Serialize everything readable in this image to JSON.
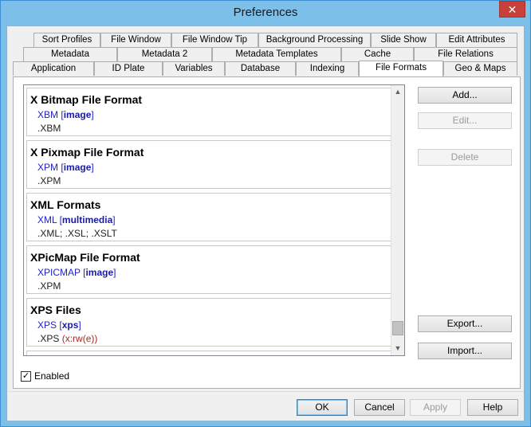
{
  "window": {
    "title": "Preferences",
    "close_glyph": "✕"
  },
  "tabs": {
    "row1": [
      "Sort Profiles",
      "File Window",
      "File Window Tip",
      "Background Processing",
      "Slide Show",
      "Edit Attributes"
    ],
    "row2": [
      "Metadata",
      "Metadata 2",
      "Metadata Templates",
      "Cache",
      "File Relations"
    ],
    "row3": [
      "Application",
      "ID Plate",
      "Variables",
      "Database",
      "Indexing",
      "File Formats",
      "Geo & Maps"
    ],
    "active": "File Formats"
  },
  "formats": [
    {
      "title": "X Bitmap File Format",
      "code": "XBM",
      "category": "image",
      "extensions": ".XBM",
      "capabilities": ""
    },
    {
      "title": "X Pixmap File Format",
      "code": "XPM",
      "category": "image",
      "extensions": ".XPM",
      "capabilities": ""
    },
    {
      "title": "XML Formats",
      "code": "XML",
      "category": "multimedia",
      "extensions": ".XML; .XSL; .XSLT",
      "capabilities": ""
    },
    {
      "title": "XPicMap File Format",
      "code": "XPICMAP",
      "category": "image",
      "extensions": ".XPM",
      "capabilities": ""
    },
    {
      "title": "XPS Files",
      "code": "XPS",
      "category": "xps",
      "extensions": ".XPS",
      "capabilities": "(x:rw(e))"
    }
  ],
  "side_buttons": {
    "add": "Add...",
    "edit": "Edit...",
    "delete": "Delete",
    "export": "Export...",
    "import": "Import..."
  },
  "enabled": {
    "label": "Enabled",
    "checked": true,
    "check_glyph": "✓"
  },
  "dialog_buttons": {
    "ok": "OK",
    "cancel": "Cancel",
    "apply": "Apply",
    "help": "Help"
  },
  "scrollbar": {
    "up_glyph": "▲",
    "down_glyph": "▼"
  }
}
